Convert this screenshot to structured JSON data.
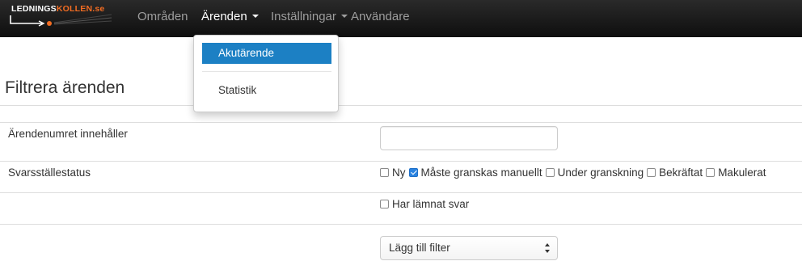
{
  "navbar": {
    "logo": {
      "part1": "LEDNINGS",
      "part2": "KOLLEN",
      "part3": ".se"
    },
    "items": [
      {
        "label": "Områden"
      },
      {
        "label": "Ärenden"
      },
      {
        "label": "Inställningar"
      },
      {
        "label": "Användare"
      }
    ]
  },
  "dropdown": {
    "items": [
      {
        "label": "Akutärende",
        "active": true
      },
      {
        "label": "Statistik",
        "active": false
      }
    ]
  },
  "page": {
    "title": "Filtrera ärenden",
    "filters": {
      "case_number_label": "Ärendenumret innehåller",
      "case_number_value": "",
      "status_label": "Svarsställestatus",
      "statuses": [
        {
          "label": "Ny",
          "checked": false
        },
        {
          "label": "Måste granskas manuellt",
          "checked": true
        },
        {
          "label": "Under granskning",
          "checked": false
        },
        {
          "label": "Bekräftat",
          "checked": false
        },
        {
          "label": "Makulerat",
          "checked": false
        },
        {
          "label": "Har lämnat svar",
          "checked": false
        }
      ],
      "add_filter": "Lägg till filter"
    }
  },
  "colors": {
    "navbar_bg": "#1a1a1a",
    "logo_accent": "#f26c22",
    "dropdown_active": "#1c80c4",
    "checkbox_checked": "#2a83e0"
  }
}
